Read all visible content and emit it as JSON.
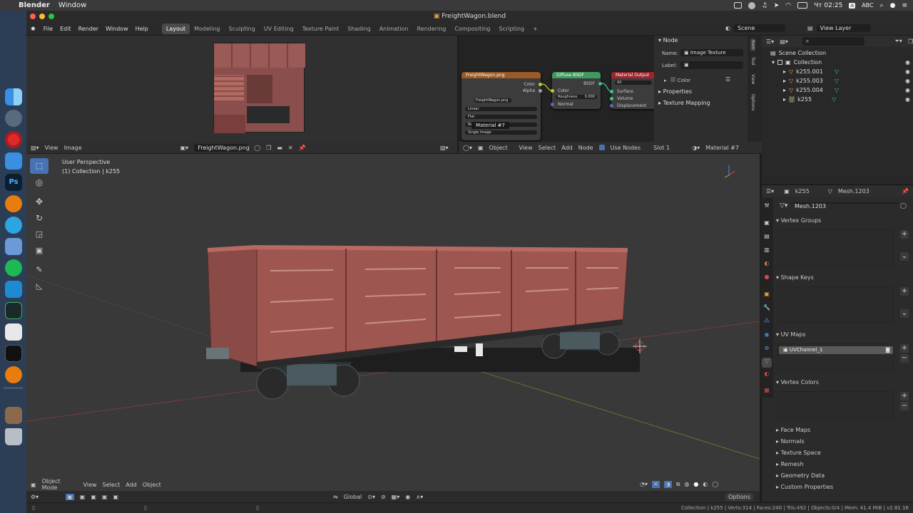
{
  "mac_menu": {
    "app": "Blender",
    "window": "Window",
    "clock": "Чт 02:25",
    "input": "ABC"
  },
  "window": {
    "title": "FreightWagon.blend"
  },
  "topbar": {
    "menus": [
      "File",
      "Edit",
      "Render",
      "Window",
      "Help"
    ],
    "workspaces": [
      "Layout",
      "Modeling",
      "Sculpting",
      "UV Editing",
      "Texture Paint",
      "Shading",
      "Animation",
      "Rendering",
      "Compositing",
      "Scripting"
    ],
    "active_workspace": "Layout",
    "scene": "Scene",
    "view_layer": "View Layer"
  },
  "image_editor": {
    "menus": [
      "View",
      "Image"
    ],
    "image": "FreightWagon.png"
  },
  "node_editor": {
    "object": "Object",
    "menus": [
      "View",
      "Select",
      "Add",
      "Node"
    ],
    "use_nodes": "Use Nodes",
    "slot": "Slot 1",
    "material": "Material #7",
    "tex_node": {
      "title": "FreightWagon.png",
      "out_color": "Color",
      "out_alpha": "Alpha",
      "image": "FreightWagon.png",
      "interp": "Linear",
      "proj": "Flat",
      "ext": "Repeat",
      "source": "Single Image",
      "tooltip": "Material #7"
    },
    "bsdf_node": {
      "title": "Diffuse BSDF",
      "out": "BSDF",
      "in_color": "Color",
      "roughness": "Roughness",
      "rough_val": "0.000",
      "normal": "Normal"
    },
    "out_node": {
      "title": "Material Output",
      "target": "All",
      "surface": "Surface",
      "volume": "Volume",
      "displacement": "Displacement"
    }
  },
  "n_panel": {
    "section": "Node",
    "name_label": "Name:",
    "name_value": "Image Texture",
    "label_label": "Label:",
    "color": "Color",
    "properties": "Properties",
    "texture_mapping": "Texture Mapping",
    "tabs": [
      "Item",
      "Tool",
      "View",
      "Options"
    ]
  },
  "outliner": {
    "root": "Scene Collection",
    "collection": "Collection",
    "items": [
      "k255.001",
      "k255.003",
      "k255.004",
      "k255"
    ]
  },
  "viewport": {
    "perspective": "User Perspective",
    "context": "(1) Collection | k255",
    "mode": "Object Mode",
    "menus": [
      "View",
      "Select",
      "Add",
      "Object"
    ],
    "transform": "Global",
    "options": "Options"
  },
  "properties": {
    "object": "k255",
    "mesh": "Mesh.1203",
    "mesh_field": "Mesh.1203",
    "vertex_groups": "Vertex Groups",
    "shape_keys": "Shape Keys",
    "uv_maps": "UV Maps",
    "uv_channel": "UVChannel_1",
    "vertex_colors": "Vertex Colors",
    "collapsed": [
      "Face Maps",
      "Normals",
      "Texture Space",
      "Remesh",
      "Geometry Data",
      "Custom Properties"
    ]
  },
  "statusbar": {
    "text": "Collection | k255 | Verts:314 | Faces:240 | Tris:492 | Objects:0/4 | Mem: 41.4 MiB | v2.81.16"
  },
  "colors": {
    "accent": "#4772b3",
    "tex_header": "#9b5a26",
    "shader_header": "#3f9a5d",
    "output_header": "#a0242c",
    "wagon": "#9e5650"
  }
}
